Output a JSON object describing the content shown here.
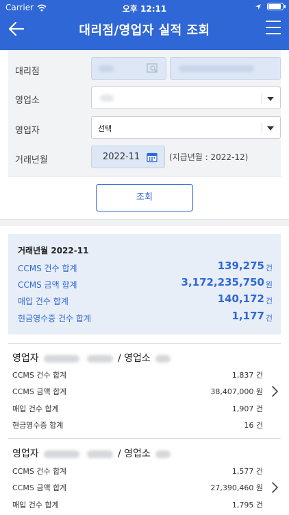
{
  "status": {
    "carrier": "Carrier",
    "time": "오후 12:11"
  },
  "nav": {
    "title": "대리점/영업자 실적 조회"
  },
  "form": {
    "agency_label": "대리점",
    "branch_label": "영업소",
    "salesperson_label": "영업자",
    "salesperson_value": "선택",
    "month_label": "거래년월",
    "month_value": "2022-11",
    "pay_note": "(지급년월 : 2022-12)",
    "search_button": "조회"
  },
  "summary": {
    "title": "거래년월  2022-11",
    "rows": [
      {
        "label": "CCMS 건수 합계",
        "value": "139,275",
        "unit": "건"
      },
      {
        "label": "CCMS 금액 합계",
        "value": "3,172,235,750",
        "unit": "원"
      },
      {
        "label": "매입 건수 합계",
        "value": "140,172",
        "unit": "건"
      },
      {
        "label": "현금영수증 건수 합계",
        "value": "1,177",
        "unit": "건"
      }
    ]
  },
  "sales": [
    {
      "head_prefix": "영업자",
      "head_mid": "/ 영업소",
      "rows": [
        {
          "label": "CCMS 건수 합계",
          "value": "1,837 건"
        },
        {
          "label": "CCMS 금액 합계",
          "value": "38,407,000 원"
        },
        {
          "label": "매입 건수 합계",
          "value": "1,907 건"
        },
        {
          "label": "현금영수증 합계",
          "value": "16 건"
        }
      ]
    },
    {
      "head_prefix": "영업자",
      "head_mid": "/ 영업소",
      "rows": [
        {
          "label": "CCMS 건수 합계",
          "value": "1,577 건"
        },
        {
          "label": "CCMS 금액 합계",
          "value": "27,390,460 원"
        },
        {
          "label": "매입 건수 합계",
          "value": "1,795 건"
        }
      ]
    }
  ],
  "colors": {
    "primary": "#2f67d6",
    "summary_bg": "#e8eef7"
  },
  "icons": [
    "wifi-icon",
    "location-icon",
    "battery-icon",
    "back-arrow-icon",
    "hamburger-menu-icon",
    "search-code-icon",
    "calendar-icon",
    "dropdown-arrow-icon",
    "chevron-right-icon"
  ]
}
